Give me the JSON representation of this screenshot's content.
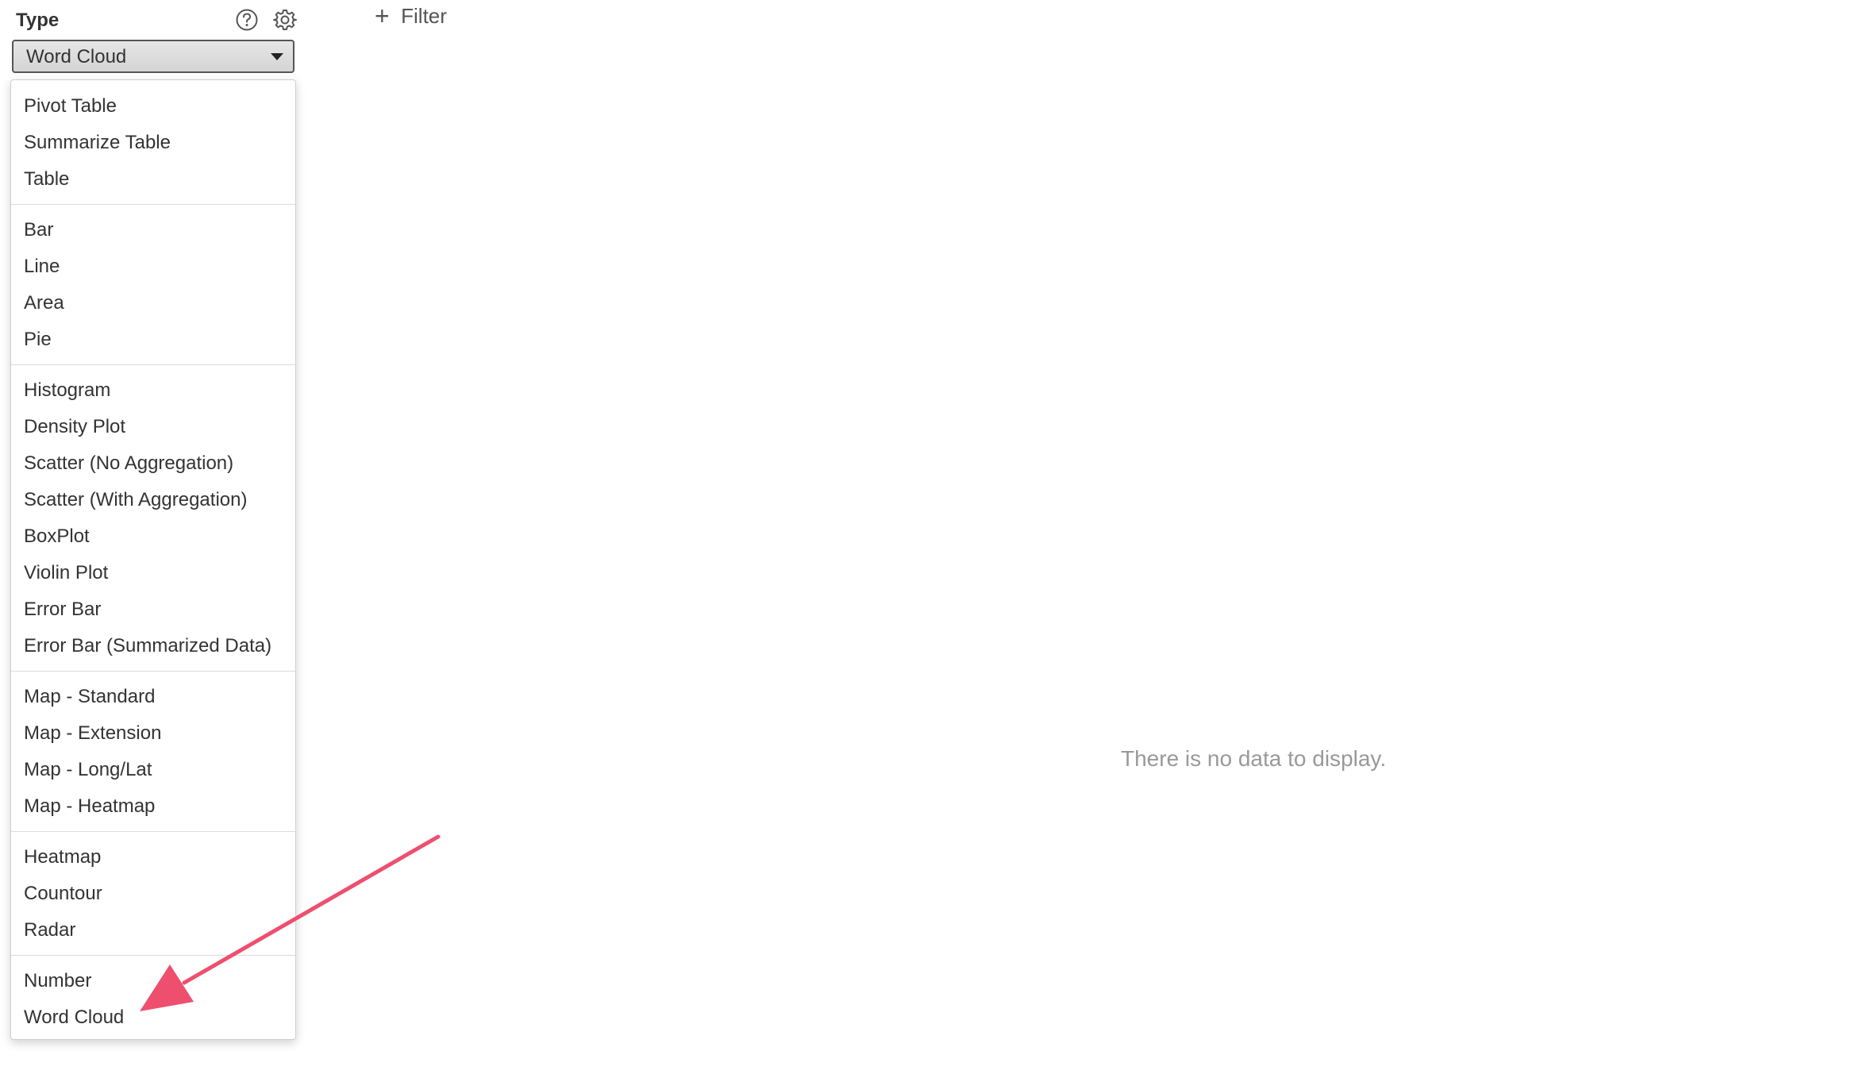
{
  "panel": {
    "type_label": "Type",
    "help_icon": "question-circle-icon",
    "settings_icon": "gear-icon",
    "selected_value": "Word Cloud"
  },
  "dropdown": {
    "groups": [
      {
        "items": [
          "Pivot Table",
          "Summarize Table",
          "Table"
        ]
      },
      {
        "items": [
          "Bar",
          "Line",
          "Area",
          "Pie"
        ]
      },
      {
        "items": [
          "Histogram",
          "Density Plot",
          "Scatter (No Aggregation)",
          "Scatter (With Aggregation)",
          "BoxPlot",
          "Violin Plot",
          "Error Bar",
          "Error Bar (Summarized Data)"
        ]
      },
      {
        "items": [
          "Map - Standard",
          "Map - Extension",
          "Map - Long/Lat",
          "Map - Heatmap"
        ]
      },
      {
        "items": [
          "Heatmap",
          "Countour",
          "Radar"
        ]
      },
      {
        "items": [
          "Number",
          "Word Cloud"
        ]
      }
    ]
  },
  "toolbar": {
    "filter_icon": "plus-icon",
    "filter_label": "Filter"
  },
  "main": {
    "empty_message": "There is no data to display."
  },
  "colors": {
    "annotation_arrow": "#ee4f6e",
    "empty_text": "#999999"
  }
}
